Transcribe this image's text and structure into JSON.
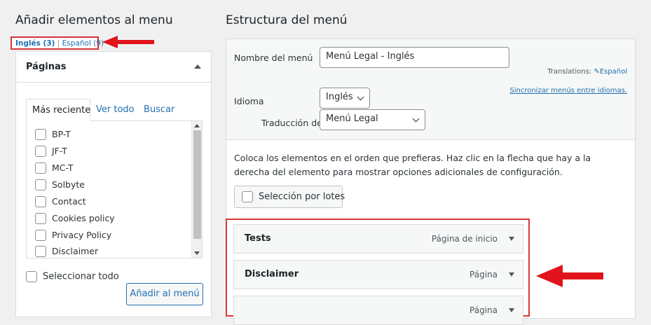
{
  "left": {
    "title": "Añadir elementos al menu",
    "lang_current": "Inglés (3)",
    "lang_separator": "|",
    "lang_other": "Español (9)",
    "panel_title": "Páginas",
    "tabs": [
      "Más reciente",
      "Ver todo",
      "Buscar"
    ],
    "items": [
      "BP-T",
      "JF-T",
      "MC-T",
      "Solbyte",
      "Contact",
      "Cookies policy",
      "Privacy Policy",
      "Disclaimer"
    ],
    "select_all": "Seleccionar todo",
    "add_button": "Añadir al menú"
  },
  "right": {
    "title": "Estructura del menú",
    "menu_name_label": "Nombre del menú",
    "menu_name_value": "Menú Legal - Inglés",
    "translations_label": "Translations:",
    "translations_link": "Español",
    "sync_link": "Sincronizar menús entre idiomas.",
    "language_label": "Idioma",
    "language_value": "Inglés",
    "translation_label": "Traducción de",
    "translation_value": "Menú Legal",
    "instructions": "Coloca los elementos en el orden que prefieras. Haz clic en la flecha que hay a la derecha del elemento para mostrar opciones adicionales de configuración.",
    "bulk_select": "Selección por lotes",
    "menu_items": [
      {
        "title": "Tests",
        "type": "Página de inicio"
      },
      {
        "title": "Disclaimer",
        "type": "Página"
      },
      {
        "title": "",
        "type": "Página"
      }
    ]
  },
  "colors": {
    "highlight_red": "#d63638",
    "link_blue": "#2271b1",
    "background": "#f0f0f1"
  }
}
